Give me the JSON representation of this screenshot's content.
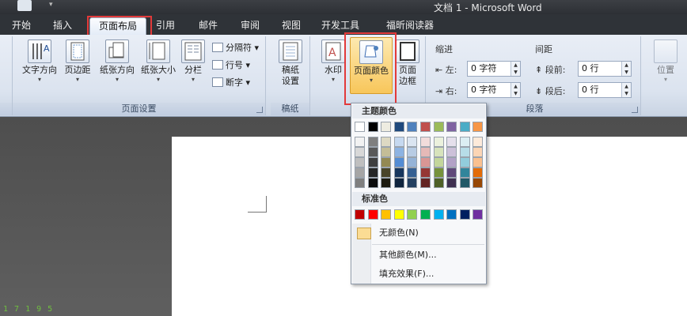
{
  "window": {
    "title": "文档 1 - Microsoft Word"
  },
  "tabs": [
    {
      "label": "开始"
    },
    {
      "label": "插入"
    },
    {
      "label": "页面布局"
    },
    {
      "label": "引用"
    },
    {
      "label": "邮件"
    },
    {
      "label": "审阅"
    },
    {
      "label": "视图"
    },
    {
      "label": "开发工具"
    },
    {
      "label": "福昕阅读器"
    }
  ],
  "active_tab": "页面布局",
  "ribbon": {
    "page_setup": {
      "buttons": [
        {
          "label": "文字方向"
        },
        {
          "label": "页边距"
        },
        {
          "label": "纸张方向"
        },
        {
          "label": "纸张大小"
        },
        {
          "label": "分栏"
        }
      ],
      "small_buttons": [
        {
          "label": "分隔符"
        },
        {
          "label": "行号"
        },
        {
          "label": "断字"
        }
      ],
      "group_label": "页面设置"
    },
    "draft": {
      "button_line1": "稿纸",
      "button_line2": "设置",
      "group_label": "稿纸"
    },
    "page_background": {
      "watermark": "水印",
      "page_color": "页面颜色",
      "page_border_line1": "页面",
      "page_border_line2": "边框"
    },
    "paragraph": {
      "indent_label": "缩进",
      "spacing_label": "间距",
      "left_label": "左:",
      "right_label": "右:",
      "before_label": "段前:",
      "after_label": "段后:",
      "left_value": "0 字符",
      "right_value": "0 字符",
      "before_value": "0 行",
      "after_value": "0 行",
      "group_label": "段落"
    },
    "arrange": {
      "position": "位置"
    }
  },
  "dropdown": {
    "theme_colors_heading": "主题颜色",
    "standard_colors_heading": "标准色",
    "theme_top_colors": [
      "#ffffff",
      "#000000",
      "#eeece1",
      "#1f497d",
      "#4f81bd",
      "#c0504d",
      "#9bbb59",
      "#8064a2",
      "#4bacc6",
      "#f79646"
    ],
    "theme_shades": [
      [
        "#f2f2f2",
        "#7f7f7f",
        "#ddd9c3",
        "#c6d9f0",
        "#dbe5f1",
        "#f2dcdb",
        "#ebf1dd",
        "#e5e0ec",
        "#dbeef3",
        "#fdeada"
      ],
      [
        "#d8d8d8",
        "#595959",
        "#c4bd97",
        "#8db3e2",
        "#b8cce4",
        "#e5b9b7",
        "#d7e3bc",
        "#ccc1d9",
        "#b7dde8",
        "#fbd5b5"
      ],
      [
        "#bfbfbf",
        "#3f3f3f",
        "#938953",
        "#548dd4",
        "#95b3d7",
        "#d99694",
        "#c3d69b",
        "#b2a2c7",
        "#92cddc",
        "#fac08f"
      ],
      [
        "#a5a5a5",
        "#262626",
        "#494429",
        "#17365d",
        "#366092",
        "#953734",
        "#76923c",
        "#5f497a",
        "#31859b",
        "#e36c09"
      ],
      [
        "#7f7f7f",
        "#0c0c0c",
        "#1d1b10",
        "#0f243e",
        "#244061",
        "#632423",
        "#4f6128",
        "#3f3151",
        "#205867",
        "#974806"
      ]
    ],
    "standard_colors": [
      "#c00000",
      "#ff0000",
      "#ffc000",
      "#ffff00",
      "#92d050",
      "#00b050",
      "#00b0f0",
      "#0070c0",
      "#002060",
      "#7030a0"
    ],
    "no_color": "无颜色(N)",
    "more_colors": "其他颜色(M)...",
    "fill_effects": "填充效果(F)..."
  },
  "status": {
    "text": "1 7 1 9 5"
  },
  "colors": {
    "highlight_box": "#e23a3a",
    "active_button": "#fbd37a"
  }
}
